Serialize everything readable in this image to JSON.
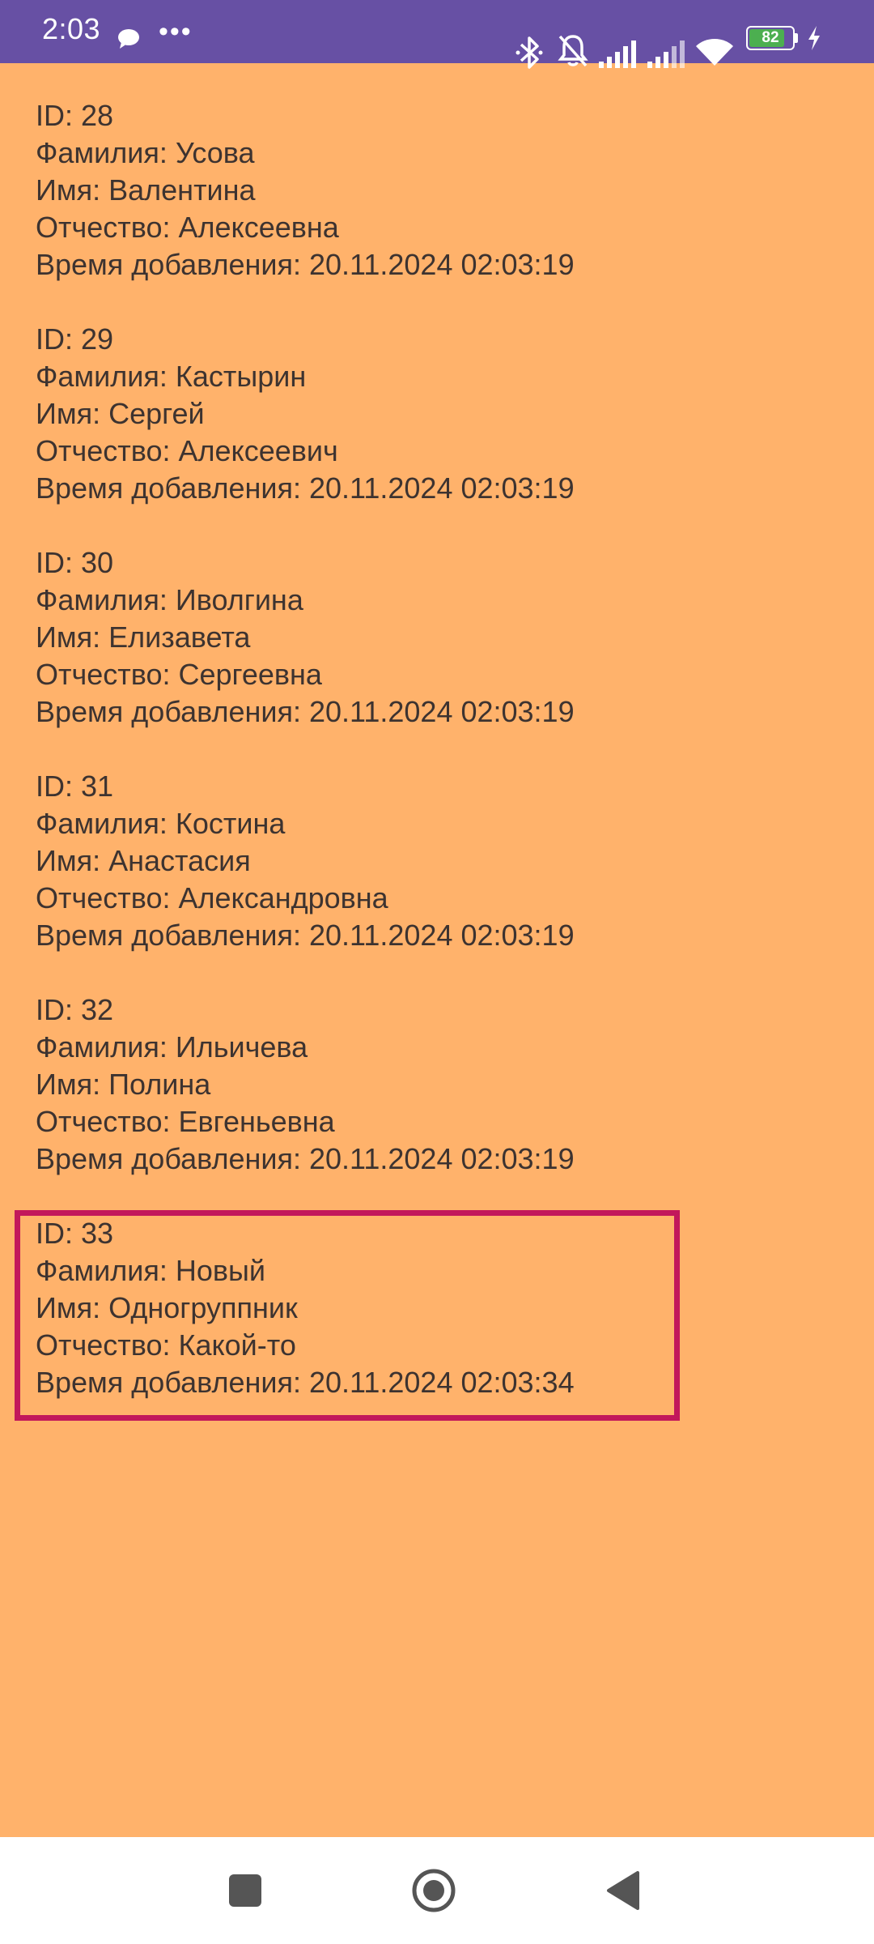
{
  "status_bar": {
    "time": "2:03",
    "battery_level": "82",
    "colors": {
      "background": "#6750a4",
      "battery_fill": "#4caf50"
    },
    "icons": [
      "chat-bubble-icon",
      "more-dots-icon",
      "bluetooth-icon",
      "bell-off-icon",
      "signal-icon",
      "signal-icon",
      "wifi-icon",
      "battery-icon",
      "charging-bolt-icon"
    ]
  },
  "records": [
    {
      "id": "ID: 28",
      "surname": "Фамилия: Усова",
      "name": "Имя: Валентина",
      "patronymic": "Отчество: Алексеевна",
      "added": "Время добавления: 20.11.2024 02:03:19"
    },
    {
      "id": "ID: 29",
      "surname": "Фамилия: Кастырин",
      "name": "Имя: Сергей",
      "patronymic": "Отчество: Алексеевич",
      "added": "Время добавления: 20.11.2024 02:03:19"
    },
    {
      "id": "ID: 30",
      "surname": "Фамилия: Иволгина",
      "name": "Имя: Елизавета",
      "patronymic": "Отчество: Сергеевна",
      "added": "Время добавления: 20.11.2024 02:03:19"
    },
    {
      "id": "ID: 31",
      "surname": "Фамилия: Костина",
      "name": "Имя: Анастасия",
      "patronymic": "Отчество: Александровна",
      "added": "Время добавления: 20.11.2024 02:03:19"
    },
    {
      "id": "ID: 32",
      "surname": "Фамилия: Ильичева",
      "name": "Имя: Полина",
      "patronymic": "Отчество: Евгеньевна",
      "added": "Время добавления: 20.11.2024 02:03:19"
    },
    {
      "id": "ID: 33",
      "surname": "Фамилия: Новый",
      "name": "Имя: Одногруппник",
      "patronymic": "Отчество: Какой-то",
      "added": "Время добавления: 20.11.2024 02:03:34"
    }
  ],
  "colors": {
    "page_background": "#ffb26b",
    "text": "#3d3330",
    "highlight_border": "#c2185b",
    "nav_background": "#ffffff"
  },
  "nav_bar": {
    "icons": [
      "recents-square-icon",
      "home-circle-icon",
      "back-triangle-icon"
    ]
  }
}
